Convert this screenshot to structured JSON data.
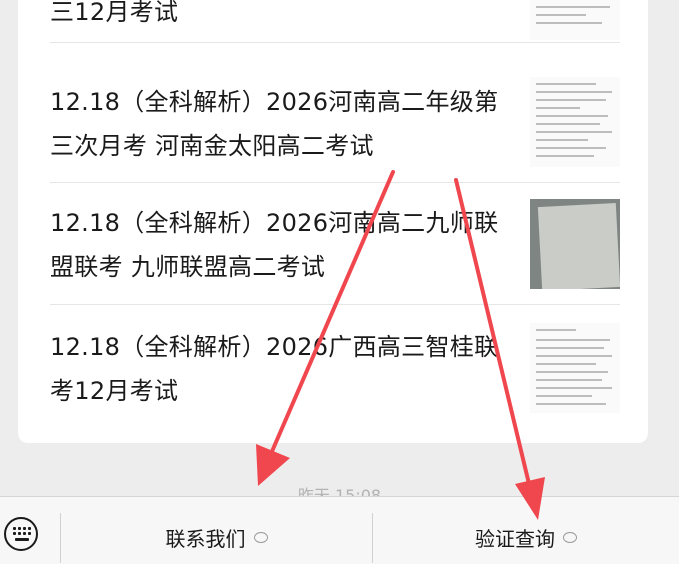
{
  "chat": {
    "items": [
      {
        "title": "三12月考试"
      },
      {
        "title": "12.18（全科解析）2026河南高二年级第三次月考 河南金太阳高二考试"
      },
      {
        "title": "12.18（全科解析）2026河南高二九师联盟联考 九师联盟高二考试"
      },
      {
        "title": "12.18（全科解析）2026广西高三智桂联考12月考试"
      }
    ],
    "timestamp": "昨天 15:08"
  },
  "bottom_menu": {
    "items": [
      {
        "label": "联系我们"
      },
      {
        "label": "验证查询"
      }
    ]
  },
  "colors": {
    "arrow": "#f0474f",
    "background": "#ededed",
    "card": "#ffffff"
  }
}
